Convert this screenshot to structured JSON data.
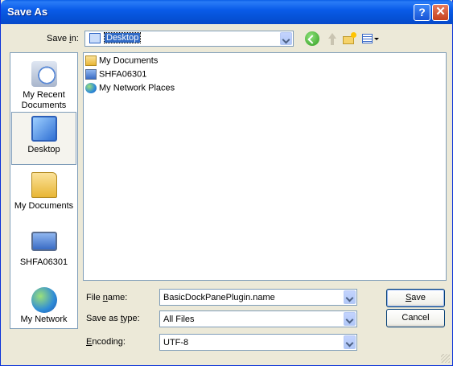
{
  "window": {
    "title": "Save As",
    "help_symbol": "?",
    "close_symbol": "✕"
  },
  "save_in": {
    "label_prefix": "Save ",
    "label_accel": "i",
    "label_suffix": "n:",
    "value": "Desktop",
    "value_icon": "desktop-icon"
  },
  "toolbar": {
    "back_icon": "back-arrow-icon",
    "up_icon": "up-folder-icon",
    "new_folder_icon": "new-folder-icon",
    "views_icon": "views-menu-icon"
  },
  "places": [
    {
      "label_line1": "My Recent",
      "label_line2": "Documents",
      "icon": "recent-documents-icon",
      "selected": false
    },
    {
      "label_line1": "Desktop",
      "label_line2": "",
      "icon": "desktop-icon",
      "selected": true
    },
    {
      "label_line1": "My Documents",
      "label_line2": "",
      "icon": "my-documents-icon",
      "selected": false
    },
    {
      "label_line1": "SHFA06301",
      "label_line2": "",
      "icon": "computer-icon",
      "selected": false
    },
    {
      "label_line1": "My Network",
      "label_line2": "",
      "icon": "network-icon",
      "selected": false
    }
  ],
  "files": [
    {
      "name": "My Documents",
      "icon": "my-documents-icon"
    },
    {
      "name": "SHFA06301",
      "icon": "computer-icon"
    },
    {
      "name": "My Network Places",
      "icon": "network-places-icon"
    }
  ],
  "form": {
    "file_name_prefix": "File ",
    "file_name_accel": "n",
    "file_name_suffix": "ame:",
    "file_name_value": "BasicDockPanePlugin.name",
    "type_prefix": "Save as ",
    "type_accel": "t",
    "type_suffix": "ype:",
    "type_value": "All Files",
    "encoding_prefix": "",
    "encoding_accel": "E",
    "encoding_suffix": "ncoding:",
    "encoding_value": "UTF-8"
  },
  "buttons": {
    "save_accel": "S",
    "save_rest": "ave",
    "cancel": "Cancel"
  }
}
